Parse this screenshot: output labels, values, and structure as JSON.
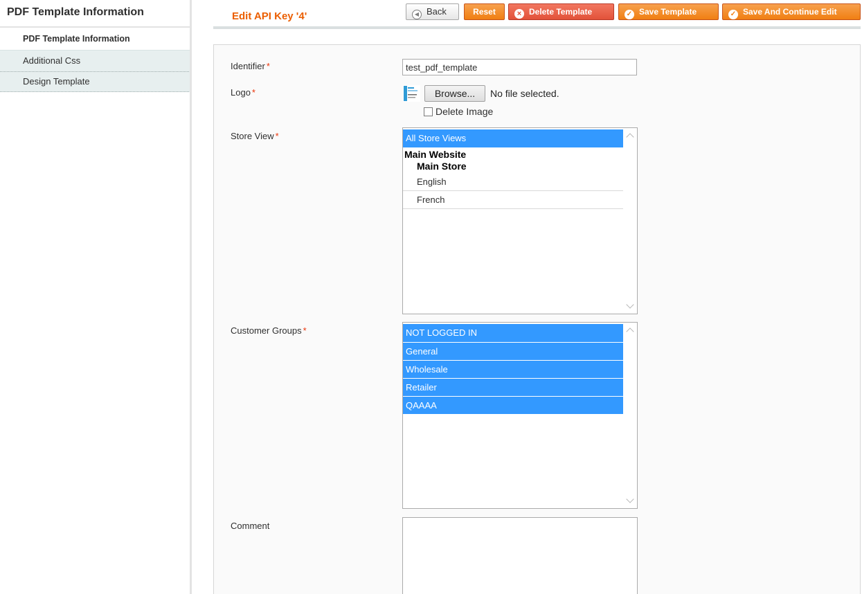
{
  "sidebar": {
    "title": "PDF Template Information",
    "tabs": [
      {
        "label": "PDF Template Information"
      },
      {
        "label": "Additional Css"
      },
      {
        "label": "Design Template"
      }
    ]
  },
  "header": {
    "title": "Edit API Key '4'",
    "buttons": {
      "back": "Back",
      "reset": "Reset",
      "delete": "Delete Template",
      "save": "Save Template",
      "save_continue": "Save And Continue Edit"
    }
  },
  "form": {
    "required_mark": "*",
    "identifier": {
      "label": "Identifier",
      "value": "test_pdf_template"
    },
    "logo": {
      "label": "Logo",
      "browse_label": "Browse...",
      "file_status": "No file selected.",
      "delete_label": "Delete Image",
      "delete_checked": false
    },
    "store_view": {
      "label": "Store View",
      "all_option": "All Store Views",
      "website": "Main Website",
      "store": "Main Store",
      "views": [
        "English",
        "French"
      ]
    },
    "customer_groups": {
      "label": "Customer Groups",
      "options": [
        "NOT LOGGED IN",
        "General",
        "Wholesale",
        "Retailer",
        "QAAAA"
      ]
    },
    "comment": {
      "label": "Comment",
      "value": ""
    }
  },
  "colors": {
    "accent": "#eb5e00",
    "button": "#f07f12",
    "delete_button": "#e2523a",
    "selection": "#3399ff"
  }
}
